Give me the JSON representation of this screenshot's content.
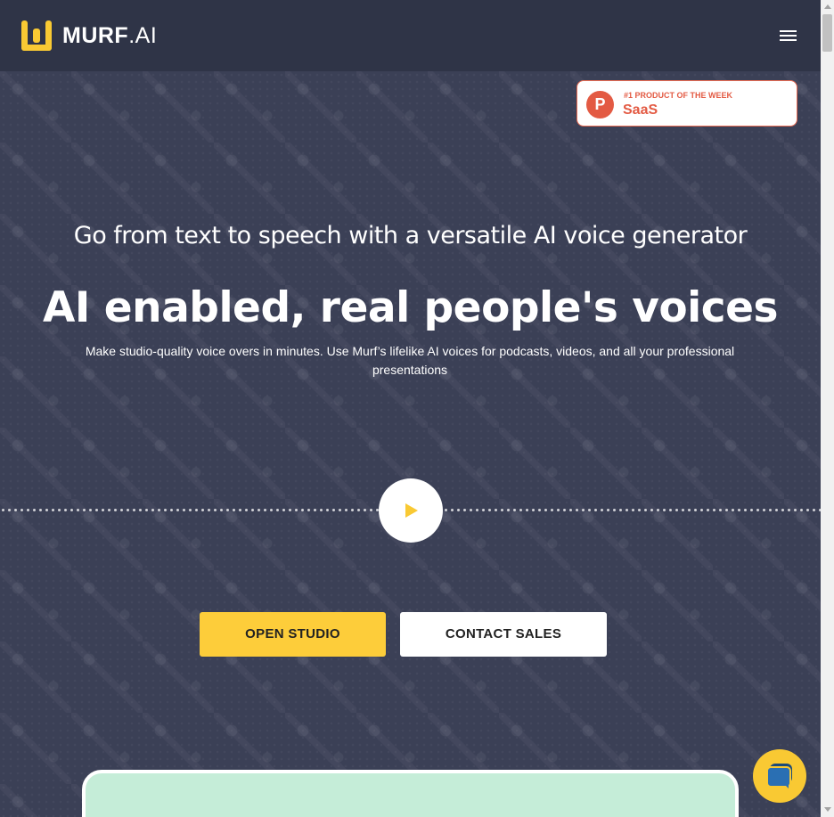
{
  "header": {
    "logo_bold": "MURF",
    "logo_light": ".AI",
    "menu_icon": "hamburger-menu-icon"
  },
  "badge": {
    "icon_letter": "P",
    "label": "#1 PRODUCT OF THE WEEK",
    "category": "SaaS"
  },
  "hero": {
    "subheading": "Go from text to speech with a versatile AI voice generator",
    "headline": "AI enabled, real people's voices",
    "description": "Make studio-quality voice overs in minutes. Use Murf’s lifelike AI voices for podcasts, videos, and all your professional presentations",
    "play_icon": "play-icon"
  },
  "actions": {
    "open_studio": "OPEN STUDIO",
    "contact_sales": "CONTACT SALES"
  },
  "chat": {
    "icon": "chat-bubble-icon"
  },
  "colors": {
    "accent": "#fdcd3a",
    "header_bg": "#2f3447",
    "hero_bg": "#3b4056",
    "badge": "#e35a43",
    "preview_bg": "#c5edd8"
  }
}
